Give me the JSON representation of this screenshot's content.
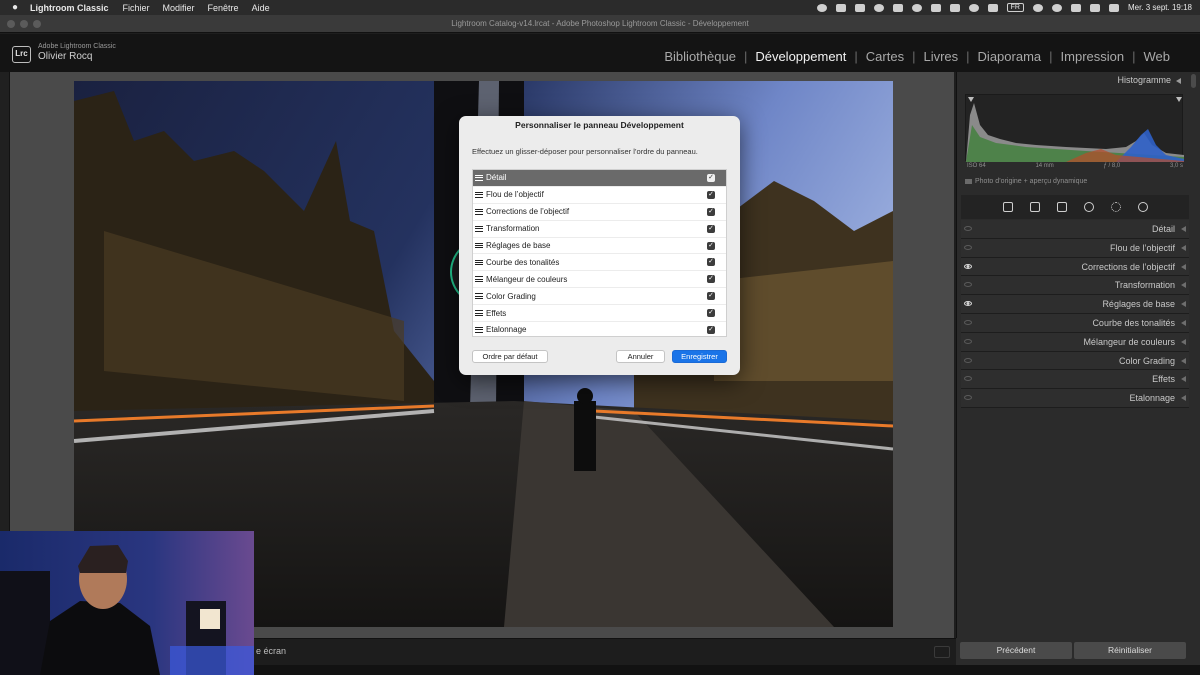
{
  "menubar": {
    "app_name": "Lightroom Classic",
    "items": [
      "Fichier",
      "Modifier",
      "Fenêtre",
      "Aide"
    ],
    "lang_badge": "FR",
    "datetime": "Mer. 3 sept. 19:18"
  },
  "window": {
    "title": "Lightroom Catalog-v14.lrcat - Adobe Photoshop Lightroom Classic - Développement"
  },
  "identity": {
    "logo": "Lrc",
    "app_subtitle": "Adobe Lightroom Classic",
    "user": "Olivier Rocq"
  },
  "modules": {
    "items": [
      "Bibliothèque",
      "Développement",
      "Cartes",
      "Livres",
      "Diaporama",
      "Impression",
      "Web"
    ],
    "active": "Développement"
  },
  "dialog": {
    "title": "Personnaliser le panneau Développement",
    "instructions": "Effectuez un glisser-déposer pour personnaliser l’ordre du panneau.",
    "items": [
      {
        "label": "Détail",
        "checked": true,
        "selected": true
      },
      {
        "label": "Flou de l’objectif",
        "checked": true
      },
      {
        "label": "Corrections de l’objectif",
        "checked": true
      },
      {
        "label": "Transformation",
        "checked": true
      },
      {
        "label": "Réglages de base",
        "checked": true
      },
      {
        "label": "Courbe des tonalités",
        "checked": true
      },
      {
        "label": "Mélangeur de couleurs",
        "checked": true
      },
      {
        "label": "Color Grading",
        "checked": true
      },
      {
        "label": "Effets",
        "checked": true
      },
      {
        "label": "Etalonnage",
        "checked": true
      }
    ],
    "default_button": "Ordre par défaut",
    "cancel_button": "Annuler",
    "save_button": "Enregistrer"
  },
  "histogram": {
    "header": "Histogramme",
    "iso": "ISO 64",
    "focal": "14 mm",
    "aperture": "ƒ / 8,0",
    "shutter": "3,0 s",
    "preview_label": "Photo d’origine + aperçu dynamique"
  },
  "panels": [
    {
      "label": "Détail",
      "eye": false
    },
    {
      "label": "Flou de l’objectif",
      "eye": false
    },
    {
      "label": "Corrections de l’objectif",
      "eye": true
    },
    {
      "label": "Transformation",
      "eye": false
    },
    {
      "label": "Réglages de base",
      "eye": true
    },
    {
      "label": "Courbe des tonalités",
      "eye": false
    },
    {
      "label": "Mélangeur de couleurs",
      "eye": false
    },
    {
      "label": "Color Grading",
      "eye": false
    },
    {
      "label": "Effets",
      "eye": false
    },
    {
      "label": "Etalonnage",
      "eye": false
    }
  ],
  "bottom": {
    "toolbar_label": "e écran",
    "previous_button": "Précédent",
    "reset_button": "Réinitialiser"
  },
  "colors": {
    "accent_button": "#1a74e8",
    "cursor_ring": "#22c891",
    "cursor_arrow": "#e02a2a"
  }
}
